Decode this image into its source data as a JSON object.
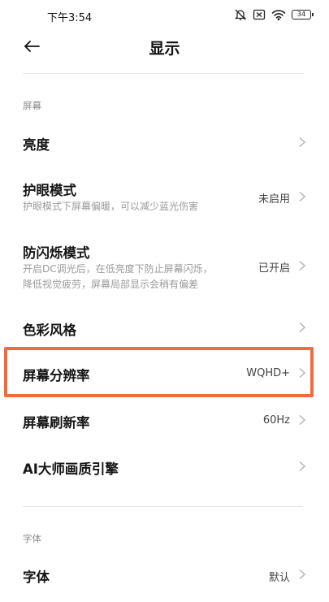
{
  "status_bar": {
    "time": "下午3:54",
    "battery": "34"
  },
  "header": {
    "title": "显示"
  },
  "sections": {
    "screen": "屏幕",
    "font": "字体"
  },
  "rows": {
    "brightness": {
      "title": "亮度"
    },
    "eye_care": {
      "title": "护眼模式",
      "subtitle": "护眼模式下屏幕偏暖，可以减少蓝光伤害",
      "value": "未启用"
    },
    "anti_flicker": {
      "title": "防闪烁模式",
      "subtitle_1": "开启DC调光后，在低亮度下防止屏幕闪烁，",
      "subtitle_2": "降低视觉疲劳，屏幕局部显示会稍有偏差",
      "value": "已开启"
    },
    "color_style": {
      "title": "色彩风格"
    },
    "resolution": {
      "title": "屏幕分辨率",
      "value": "WQHD+"
    },
    "refresh_rate": {
      "title": "屏幕刷新率",
      "value": "60Hz"
    },
    "ai_engine": {
      "title": "AI大师画质引擎"
    },
    "font": {
      "title": "字体",
      "value": "默认"
    }
  },
  "colors": {
    "highlight": "#f26b3a",
    "text": "#151515",
    "muted": "#9a9a9a"
  },
  "icons": [
    "back-arrow-icon",
    "mute-icon",
    "sim-icon",
    "wifi-icon",
    "battery-icon",
    "chevron-right-icon"
  ]
}
